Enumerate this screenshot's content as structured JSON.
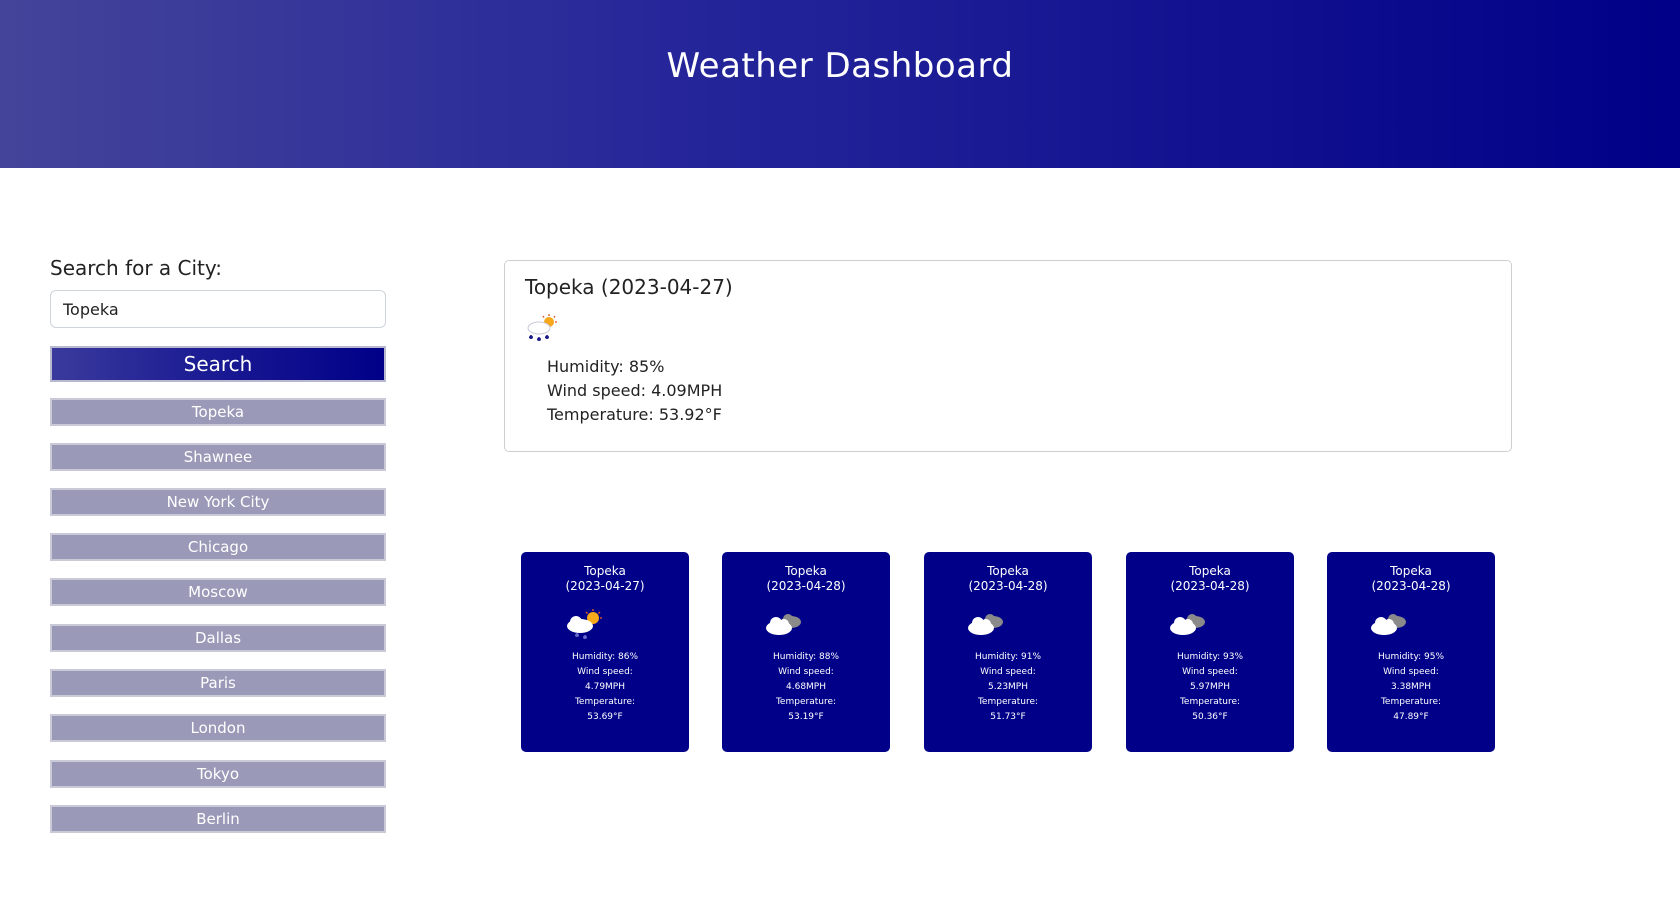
{
  "header": {
    "title": "Weather Dashboard"
  },
  "search": {
    "label": "Search for a City:",
    "value": "Topeka",
    "button_label": "Search"
  },
  "history": [
    "Topeka",
    "Shawnee",
    "New York City",
    "Chicago",
    "Moscow",
    "Dallas",
    "Paris",
    "London",
    "Tokyo",
    "Berlin"
  ],
  "current": {
    "title": "Topeka (2023-04-27)",
    "icon": "rain-sun-icon",
    "humidity": "Humidity: 85%",
    "wind": "Wind speed: 4.09MPH",
    "temperature": "Temperature: 53.92°F"
  },
  "forecast": [
    {
      "city": "Topeka",
      "date": "(2023-04-27)",
      "icon": "rain-sun-icon",
      "humidity": "Humidity: 86%",
      "wind_label": "Wind speed:",
      "wind": "4.79MPH",
      "temp_label": "Temperature:",
      "temp": "53.69°F"
    },
    {
      "city": "Topeka",
      "date": "(2023-04-28)",
      "icon": "cloudy-icon",
      "humidity": "Humidity: 88%",
      "wind_label": "Wind speed:",
      "wind": "4.68MPH",
      "temp_label": "Temperature:",
      "temp": "53.19°F"
    },
    {
      "city": "Topeka",
      "date": "(2023-04-28)",
      "icon": "cloudy-icon",
      "humidity": "Humidity: 91%",
      "wind_label": "Wind speed:",
      "wind": "5.23MPH",
      "temp_label": "Temperature:",
      "temp": "51.73°F"
    },
    {
      "city": "Topeka",
      "date": "(2023-04-28)",
      "icon": "cloudy-icon",
      "humidity": "Humidity: 93%",
      "wind_label": "Wind speed:",
      "wind": "5.97MPH",
      "temp_label": "Temperature:",
      "temp": "50.36°F"
    },
    {
      "city": "Topeka",
      "date": "(2023-04-28)",
      "icon": "cloudy-icon",
      "humidity": "Humidity: 95%",
      "wind_label": "Wind speed:",
      "wind": "3.38MPH",
      "temp_label": "Temperature:",
      "temp": "47.89°F"
    }
  ],
  "colors": {
    "header_start": "#44449a",
    "header_end": "#000088",
    "card_bg": "#000088",
    "history_button": "#9a9ab8"
  }
}
